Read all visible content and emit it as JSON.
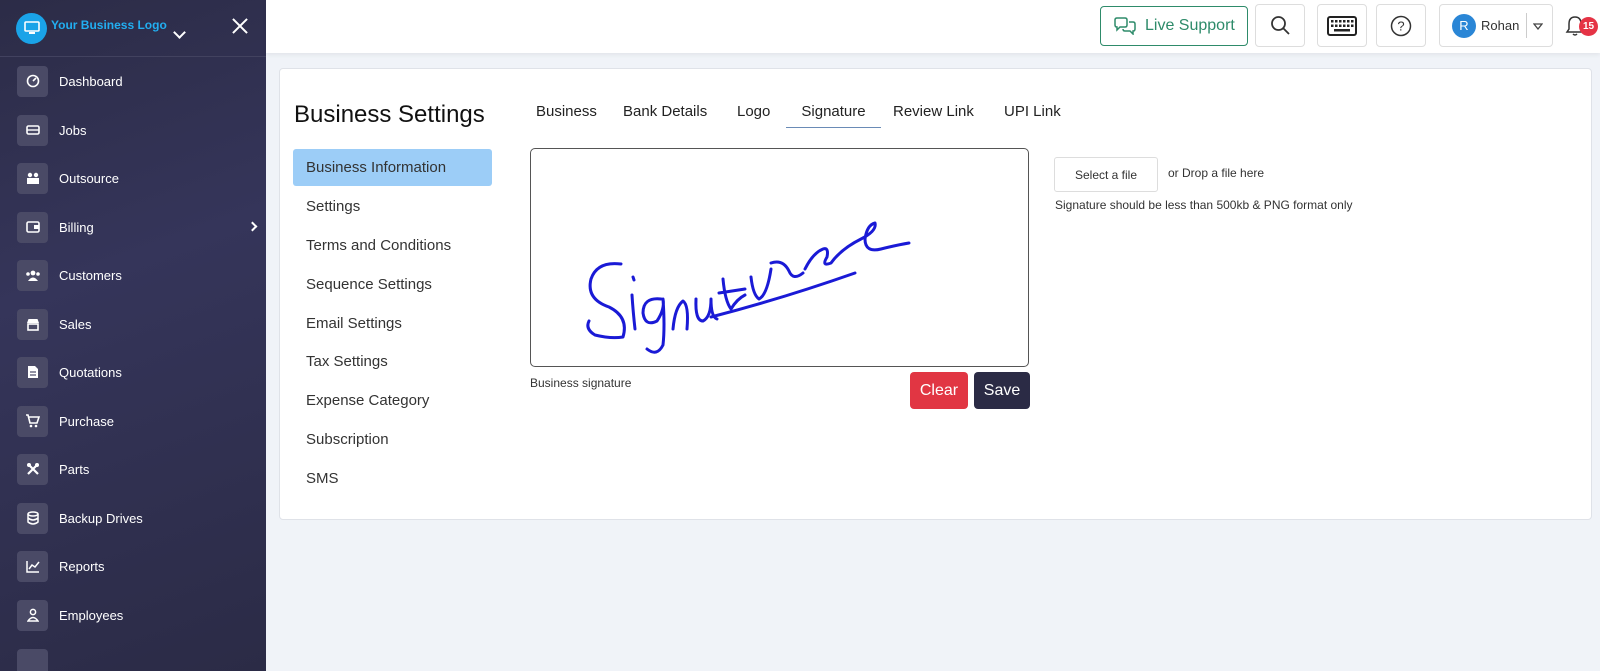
{
  "sidebar": {
    "logo_text": "Your Business Logo",
    "items": [
      {
        "label": "Dashboard",
        "icon": "dashboard-icon"
      },
      {
        "label": "Jobs",
        "icon": "jobs-icon"
      },
      {
        "label": "Outsource",
        "icon": "outsource-icon"
      },
      {
        "label": "Billing",
        "icon": "billing-icon"
      },
      {
        "label": "Customers",
        "icon": "customers-icon"
      },
      {
        "label": "Sales",
        "icon": "sales-icon"
      },
      {
        "label": "Quotations",
        "icon": "quotations-icon"
      },
      {
        "label": "Purchase",
        "icon": "purchase-icon"
      },
      {
        "label": "Parts",
        "icon": "parts-icon"
      },
      {
        "label": "Backup Drives",
        "icon": "backup-drives-icon"
      },
      {
        "label": "Reports",
        "icon": "reports-icon"
      },
      {
        "label": "Employees",
        "icon": "employees-icon"
      }
    ]
  },
  "topbar": {
    "live_support": "Live Support",
    "user_initial": "R",
    "user_name": "Rohan",
    "notification_count": "15"
  },
  "settings": {
    "title": "Business Settings",
    "menu": [
      "Business Information",
      "Settings",
      "Terms and Conditions",
      "Sequence Settings",
      "Email Settings",
      "Tax Settings",
      "Expense Category",
      "Subscription",
      "SMS"
    ],
    "active_menu": "Business Information",
    "tabs": [
      "Business",
      "Bank Details",
      "Logo",
      "Signature",
      "Review Link",
      "UPI Link"
    ],
    "active_tab": "Signature"
  },
  "signature": {
    "caption": "Business signature",
    "clear_label": "Clear",
    "save_label": "Save",
    "select_file_label": "Select a file",
    "drop_text": "or Drop a file here",
    "hint": "Signature should be less than 500kb & PNG format only",
    "handwritten_text": "Signature",
    "ink_color": "#1a1ad6"
  },
  "colors": {
    "sidebar_bg": "#2c2c47",
    "accent_green": "#2e8b6a",
    "active_menu_bg": "#9ccdf7",
    "danger": "#e13643",
    "dark_button": "#2b2b45"
  }
}
